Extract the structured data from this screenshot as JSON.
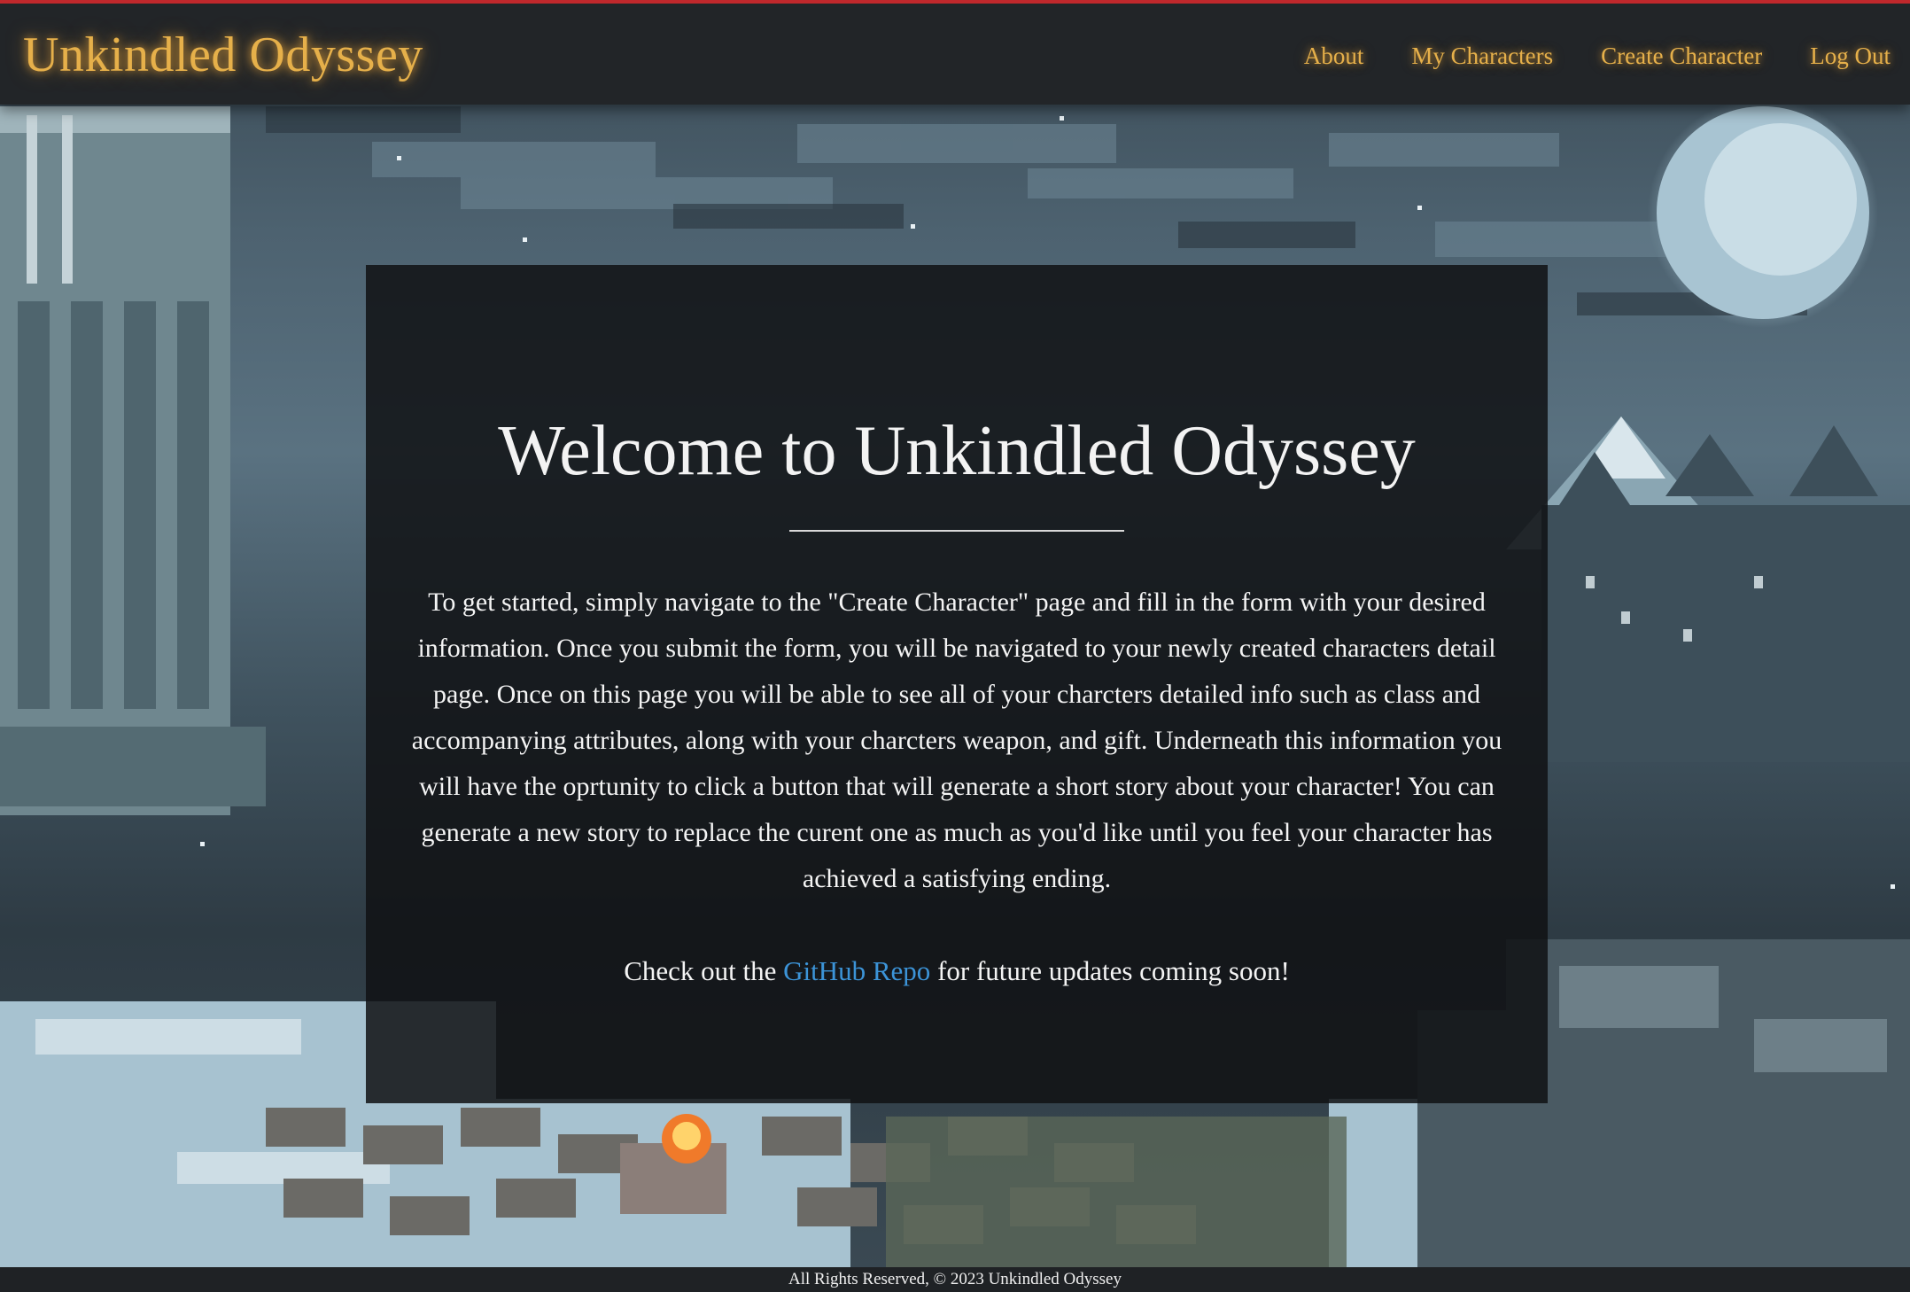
{
  "header": {
    "brand": "Unkindled Odyssey",
    "nav": {
      "about": "About",
      "my_characters": "My Characters",
      "create_character": "Create Character",
      "log_out": "Log Out"
    }
  },
  "main": {
    "title": "Welcome to Unkindled Odyssey",
    "intro": "To get started, simply navigate to the \"Create Character\" page and fill in the form with your desired information. Once you submit the form, you will be navigated to your newly created characters detail page. Once on this page you will be able to see all of your charcters detailed info such as class and accompanying attributes, along with your charcters weapon, and gift. Underneath this information you will have the oprtunity to click a button that will generate a short story about your character! You can generate a new story to replace the curent one as much as you'd like until you feel your character has achieved a satisfying ending.",
    "cta_prefix": "Check out the",
    "cta_link": "GitHub Repo",
    "cta_suffix": "for future updates coming soon!"
  },
  "footer": {
    "text": "All Rights Reserved, © 2023 Unkindled Odyssey"
  },
  "colors": {
    "accent": "#e6b04a",
    "link": "#3c94d8",
    "header_border": "#c0282c",
    "panel_bg": "#101214"
  }
}
